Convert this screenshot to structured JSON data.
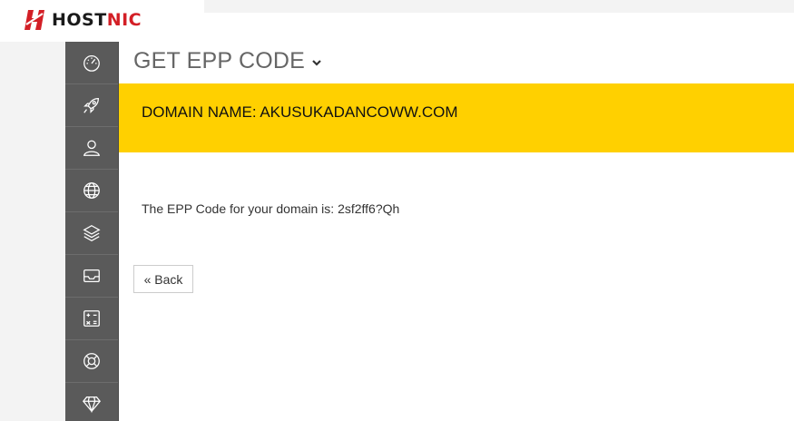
{
  "brand": {
    "name_prefix": "HOST",
    "name_suffix": "NIC",
    "accent_color": "#d31f26"
  },
  "sidebar": {
    "items": [
      {
        "icon": "speedometer-icon"
      },
      {
        "icon": "rocket-icon"
      },
      {
        "icon": "user-icon"
      },
      {
        "icon": "globe-icon"
      },
      {
        "icon": "layers-icon"
      },
      {
        "icon": "inbox-icon"
      },
      {
        "icon": "calculator-icon"
      },
      {
        "icon": "lifebuoy-icon"
      },
      {
        "icon": "diamond-icon"
      }
    ]
  },
  "header": {
    "title": "GET EPP CODE",
    "chevron_icon": "chevron-down-icon"
  },
  "banner": {
    "label": "DOMAIN NAME: AKUSUKADANCOWW.COM",
    "color": "#ffd000"
  },
  "main": {
    "epp_message": "The EPP Code for your domain is: 2sf2ff6?Qh",
    "back_label": "« Back"
  }
}
